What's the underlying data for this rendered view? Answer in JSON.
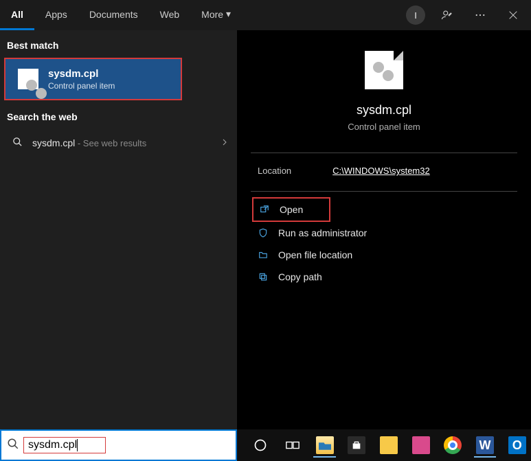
{
  "header": {
    "tabs": [
      "All",
      "Apps",
      "Documents",
      "Web",
      "More"
    ],
    "activeTab": 0,
    "userInitial": "I"
  },
  "results": {
    "bestMatchLabel": "Best match",
    "bestMatch": {
      "title": "sysdm.cpl",
      "subtitle": "Control panel item"
    },
    "webLabel": "Search the web",
    "webResult": {
      "query": "sysdm.cpl",
      "suffix": " - See web results"
    }
  },
  "preview": {
    "title": "sysdm.cpl",
    "subtitle": "Control panel item",
    "locationLabel": "Location",
    "locationValue": "C:\\WINDOWS\\system32",
    "actions": {
      "open": "Open",
      "runAdmin": "Run as administrator",
      "openLocation": "Open file location",
      "copyPath": "Copy path"
    }
  },
  "search": {
    "query": "sysdm.cpl"
  }
}
